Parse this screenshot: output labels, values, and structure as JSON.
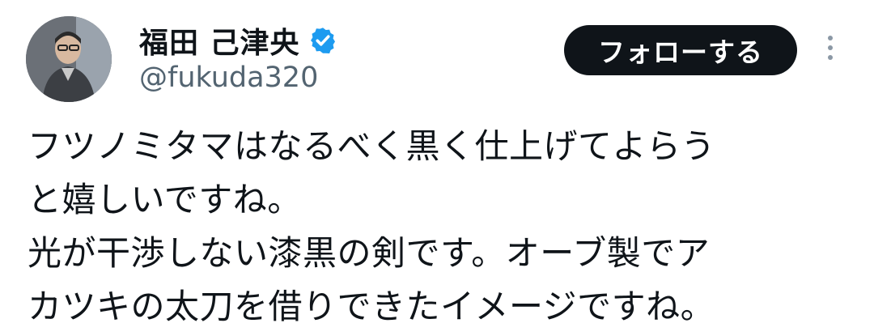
{
  "user": {
    "display_name": "福田 己津央",
    "handle": "@fukuda320",
    "verified": true
  },
  "actions": {
    "follow_label": "フォローする"
  },
  "tweet": {
    "lines": [
      "フツノミタマはなるべく黒く仕上げてよらう",
      "と嬉しいですね。",
      "光が干渉しない漆黒の剣です。オーブ製でア",
      "カツキの太刀を借りできたイメージですね。"
    ]
  },
  "colors": {
    "verified_badge": "#1d9bf0",
    "follow_button_bg": "#0f1419",
    "handle_text": "#536471"
  }
}
